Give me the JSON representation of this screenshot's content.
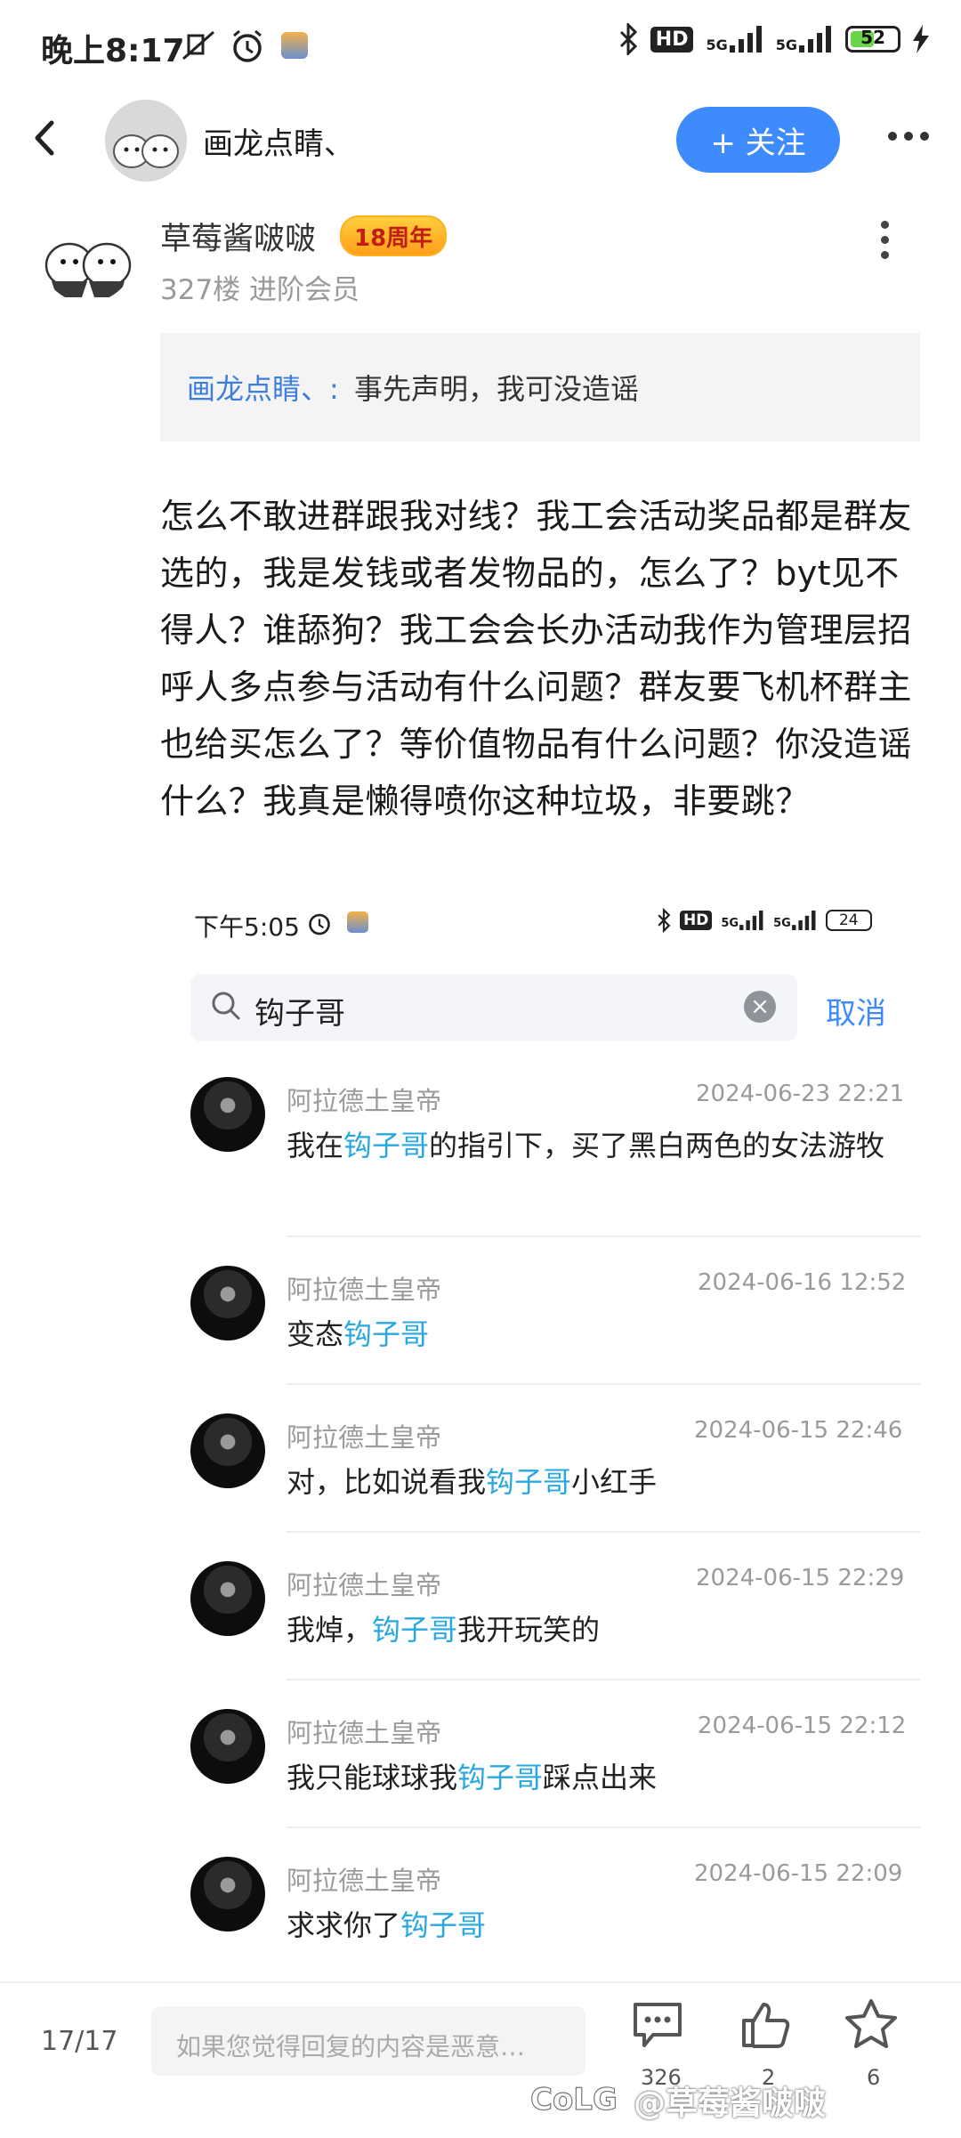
{
  "status_bar": {
    "time": "晚上8:17",
    "hd": "HD",
    "net1": "5G",
    "net2": "5G",
    "battery": "52",
    "battery_level": 0.52
  },
  "header": {
    "group_name": "画龙点睛、",
    "follow_label": "+ 关注"
  },
  "post": {
    "author": "草莓酱啵啵",
    "badge": "18周年",
    "meta": "327楼 进阶会员",
    "quote_author": "画龙点睛、:",
    "quote_text": "事先声明，我可没造谣",
    "body": "怎么不敢进群跟我对线？我工会活动奖品都是群友选的，我是发钱或者发物品的，怎么了？byt见不得人？谁舔狗？我工会会长办活动我作为管理层招呼人多点参与活动有什么问题？群友要飞机杯群主也给买怎么了？等价值物品有什么问题？你没造谣什么？我真是懒得喷你这种垃圾，非要跳？"
  },
  "embedded": {
    "status_time": "下午5:05",
    "hd": "HD",
    "net1": "5G",
    "net2": "5G",
    "battery": "24",
    "search_value": "钩子哥",
    "cancel_label": "取消",
    "messages": [
      {
        "name": "阿拉德土皇帝",
        "time": "2024-06-23 22:21",
        "before": "我在",
        "highlight": "钩子哥",
        "after": "的指引下，买了黑白两色的女法游牧"
      },
      {
        "name": "阿拉德土皇帝",
        "time": "2024-06-16 12:52",
        "before": "变态",
        "highlight": "钩子哥",
        "after": ""
      },
      {
        "name": "阿拉德土皇帝",
        "time": "2024-06-15 22:46",
        "before": "对，比如说看我",
        "highlight": "钩子哥",
        "after": "小红手"
      },
      {
        "name": "阿拉德土皇帝",
        "time": "2024-06-15 22:29",
        "before": "我焯，",
        "highlight": "钩子哥",
        "after": "我开玩笑的"
      },
      {
        "name": "阿拉德土皇帝",
        "time": "2024-06-15 22:12",
        "before": "我只能球球我",
        "highlight": "钩子哥",
        "after": "踩点出来"
      },
      {
        "name": "阿拉德土皇帝",
        "time": "2024-06-15 22:09",
        "before": "求求你了",
        "highlight": "钩子哥",
        "after": ""
      }
    ]
  },
  "bottom_bar": {
    "page_indicator": "17/17",
    "reply_placeholder": "如果您觉得回复的内容是恶意…",
    "comments_count": "326",
    "likes_count": "2",
    "favorites_count": "6",
    "watermark": "@草莓酱啵啵"
  }
}
